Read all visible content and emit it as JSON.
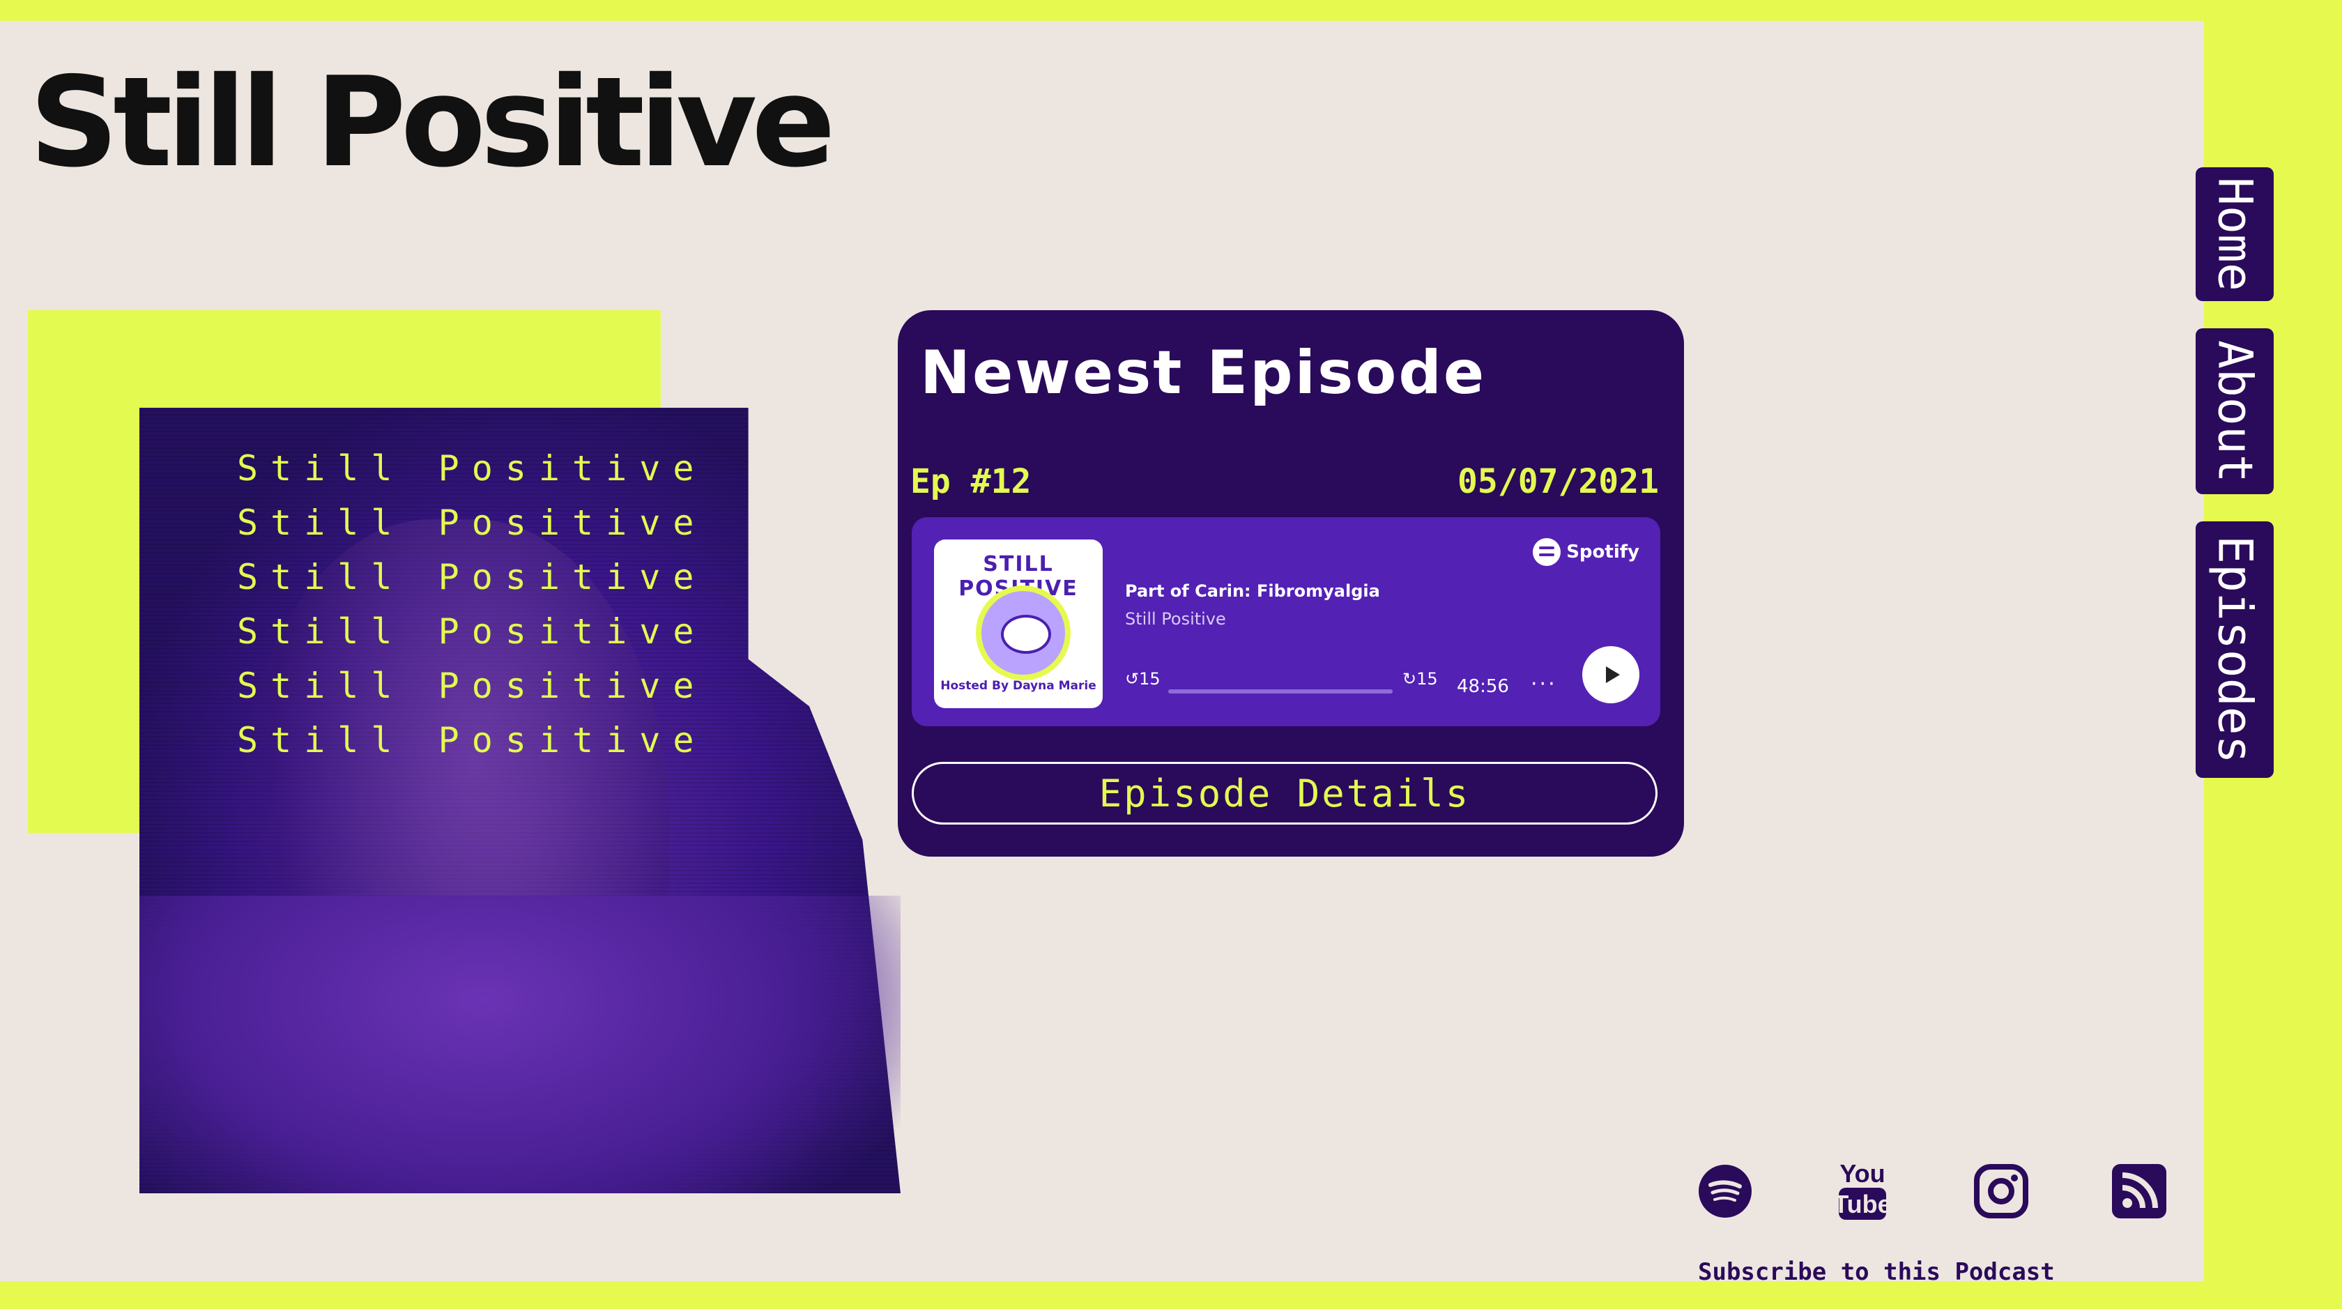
{
  "site": {
    "title": "Still Positive"
  },
  "hero": {
    "lines": [
      "Still Positive",
      "Still Positive",
      "Still Positive",
      "Still Positive",
      "Still Positive",
      "Still Positive"
    ]
  },
  "episode_card": {
    "heading": "Newest Episode",
    "episode_number": "Ep #12",
    "date": "05/07/2021",
    "player": {
      "cover_title": "STILL POSITIVE",
      "cover_subtitle": "Hosted By Dayna Marie",
      "track_title": "Part of Carin: Fibromyalgia",
      "show_name": "Still Positive",
      "provider": "Spotify",
      "skip_back_label": "15",
      "skip_forward_label": "15",
      "duration": "48:56",
      "more_label": "···",
      "progress": 0
    },
    "details_button": "Episode Details"
  },
  "nav": {
    "home": "Home",
    "about": "About",
    "episodes": "Episodes"
  },
  "social": {
    "youtube_top": "You",
    "youtube_bottom": "Tube",
    "subscribe_text": "Subscribe to this Podcast"
  },
  "colors": {
    "accent": "#e3fa50",
    "brand": "#2a0a5a",
    "player": "#5321b4",
    "page": "#ede6e0"
  }
}
